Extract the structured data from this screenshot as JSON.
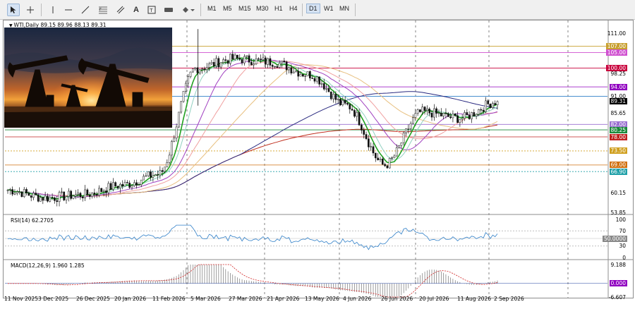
{
  "toolbar": {
    "timeframes": [
      "M1",
      "M5",
      "M15",
      "M30",
      "H1",
      "H4",
      "D1",
      "W1",
      "MN"
    ],
    "active_timeframe": "D1",
    "tools": [
      "cursor-icon",
      "crosshair-icon",
      "horizontal-line-icon",
      "trend-line-icon",
      "fibonacci-icon",
      "channel-icon",
      "text-icon",
      "label-icon",
      "rectangle-icon",
      "shapes-icon"
    ]
  },
  "chart": {
    "symbol_title": "WTI,Daily",
    "ohlc": "89.15 89.96 88.13 89.31",
    "photo_alt": "oil pumpjacks at sunset"
  },
  "price_scale": {
    "ticks": [
      "111.00",
      "98.25",
      "85.65",
      "60.15",
      "53.85"
    ],
    "levels": [
      {
        "label": "107.00",
        "color": "#c8a030"
      },
      {
        "label": "105.00",
        "color": "#d050d0"
      },
      {
        "label": "100.00",
        "color": "#c8003c"
      },
      {
        "label": "94.00",
        "color": "#9000c0"
      },
      {
        "label": "91.00",
        "color": "#2f7fc8"
      },
      {
        "label": "89.31",
        "color": "#000000"
      },
      {
        "label": "82.00",
        "color": "#9a6fd0"
      },
      {
        "label": "80.25",
        "color": "#1a8a3a"
      },
      {
        "label": "78.00",
        "color": "#c02020"
      },
      {
        "label": "73.50",
        "color": "#d0a020"
      },
      {
        "label": "69.00",
        "color": "#d07010"
      },
      {
        "label": "66.90",
        "color": "#20a0a8"
      }
    ]
  },
  "rsi": {
    "title": "RSI(14) 62.2705",
    "ticks": [
      "100",
      "70",
      "50.0000",
      "30",
      "0"
    ],
    "colors": {
      "line": "#2f7fc8"
    }
  },
  "macd": {
    "title": "MACD(12,26,9) 1.960 1.285",
    "ticks": [
      "9.188",
      "0.000",
      "-6.607"
    ],
    "colors": {
      "hist": "#606060",
      "signal": "#d02020"
    }
  },
  "time_axis": {
    "labels": [
      "11 Nov 2025",
      "3 Dec 2025",
      "26 Dec 2025",
      "20 Jan 2026",
      "11 Feb 2026",
      "5 Mar 2026",
      "27 Mar 2026",
      "21 Apr 2026",
      "13 May 2026",
      "4 Jun 2026",
      "26 Jun 2026",
      "20 Jul 2026",
      "11 Aug 2026",
      "2 Sep 2026"
    ]
  },
  "chart_data": {
    "type": "line",
    "title": "WTI,Daily",
    "categories": [
      "11 Nov 2025",
      "3 Dec 2025",
      "26 Dec 2025",
      "20 Jan 2026",
      "11 Feb 2026",
      "5 Mar 2026",
      "27 Mar 2026",
      "21 Apr 2026",
      "13 May 2026",
      "4 Jun 2026",
      "26 Jun 2026",
      "20 Jul 2026",
      "11 Aug 2026",
      "2 Sep 2026"
    ],
    "series": [
      {
        "values": [
          61.0,
          58.5,
          59.5,
          62.5,
          66.0,
          100.0,
          103.0,
          102.0,
          98.0,
          88.0,
          69.0,
          86.0,
          84.0,
          89.3
        ]
      }
    ],
    "ylim": [
      53.85,
      113.0
    ]
  }
}
